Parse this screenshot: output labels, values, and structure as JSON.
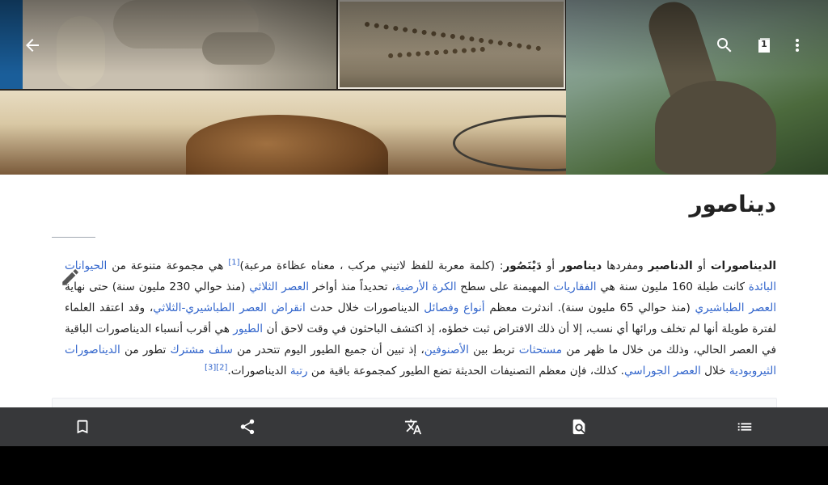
{
  "article": {
    "title": "ديناصور",
    "p1": {
      "b1": "الديناصورات",
      "t1": " أو ",
      "b2": "الدناصير",
      "t2": " ومفردها ",
      "b3": "ديناصور",
      "t3": " أو ",
      "b4": "دَيْنَصُور",
      "t4": ": (كلمة معربة للفظ لاتيني مركب ، معناه عظاءة مرعبة)",
      "ref1": "[1]",
      "t5": " هي مجموعة متنوعة من ",
      "l1": "الحيوانات البائدة",
      "t6": " كانت طيلة 160 مليون سنة هي ",
      "l2": "الفقاريات",
      "t7": " المهيمنة على سطح ",
      "l3": "الكرة الأرضية",
      "t8": "، تحديداً منذ أواخر ",
      "l4": "العصر الثلاثي",
      "t9": " (منذ حوالي 230 مليون سنة) حتى نهاية ",
      "l5": "العصر الطباشيري",
      "t10": " (منذ حوالي 65 مليون سنة). اندثرت معظم ",
      "l6": "أنواع وفصائل",
      "t11": " الديناصورات خلال حدث ",
      "l7": "انقراض العصر الطباشيري-الثلاثي",
      "t12": "، وقد اعتقد العلماء لفترة طويلة أنها لم تخلف ورائها أي نسب، إلا أن ذلك الافتراض ثبت خطؤه، إذ اكتشف الباحثون في وقت لاحق أن ",
      "l8": "الطيور",
      "t13": " هي أقرب أنسباء الديناصورات الباقية في العصر الحالي، وذلك من خلال ما ظهر من ",
      "l9": "مستحثات",
      "t14": " تربط بين ",
      "l10": "الأصنوفين",
      "t15": "، إذ تبين أن جميع الطيور اليوم تتحدر من ",
      "l11": "سلف مشترك",
      "t16": " تطور من ",
      "l12": "الديناصورات الثيروبودية",
      "t17": " خلال ",
      "l13": "العصر الجوراسي",
      "t18": ". كذلك، فإن معظم التصنيفات الحديثة تضع الطيور كمجموعة باقية من ",
      "l14": "رتبة",
      "t19": " الديناصورات.",
      "ref2": "[2]",
      "ref3": "[3]"
    }
  },
  "icons": {
    "back": "arrow-back-icon",
    "search": "search-icon",
    "tabs": "tabs-count-icon",
    "overflow": "more-vert-icon",
    "edit": "pencil-edit-icon",
    "bookmark": "bookmark-icon",
    "share": "share-icon",
    "translate": "translate-icon",
    "find": "find-in-page-icon",
    "toc": "table-of-contents-icon"
  },
  "header": {
    "tab_count": "1"
  },
  "colors": {
    "link": "#3366cc",
    "toolbar": "#37383a",
    "text": "#222222"
  }
}
